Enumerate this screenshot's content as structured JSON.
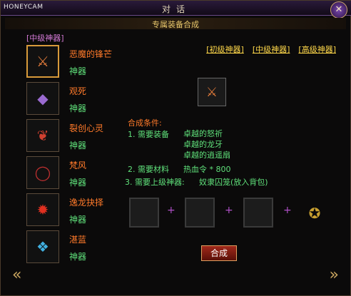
{
  "watermark": "HONEYCAM",
  "window_title": "对话",
  "subtitle": "专属装备合成",
  "tier_label": "[中级神器]",
  "items": [
    {
      "name": "恶魔的锋芒",
      "type": "神器",
      "icon": "sword-icon",
      "selected": true
    },
    {
      "name": "观死",
      "type": "神器",
      "icon": "gem-icon"
    },
    {
      "name": "裂创心灵",
      "type": "神器",
      "icon": "wing-icon"
    },
    {
      "name": "梵风",
      "type": "神器",
      "icon": "ring-icon"
    },
    {
      "name": "逸龙抉择",
      "type": "神器",
      "icon": "dragon-icon"
    },
    {
      "name": "湛蓝",
      "type": "神器",
      "icon": "crystal-icon"
    }
  ],
  "tabs": [
    "[初级神器]",
    "[中级神器]",
    "[高级神器]"
  ],
  "conditions": {
    "title": "合成条件:",
    "req1_label": "1. 需要装备",
    "req1_items": [
      "卓越的怒祈",
      "卓越的龙牙",
      "卓越的逍遥扇"
    ],
    "req2_label": "2. 需要材料",
    "req2_value": "热血令 * 800",
    "req3_label": "3. 需要上级神器:",
    "req3_value": "奴隶囚笼(放入背包)"
  },
  "plus": "+",
  "craft_button": "合成",
  "close": "✕",
  "nav": {
    "prev": "«",
    "next": "»"
  }
}
